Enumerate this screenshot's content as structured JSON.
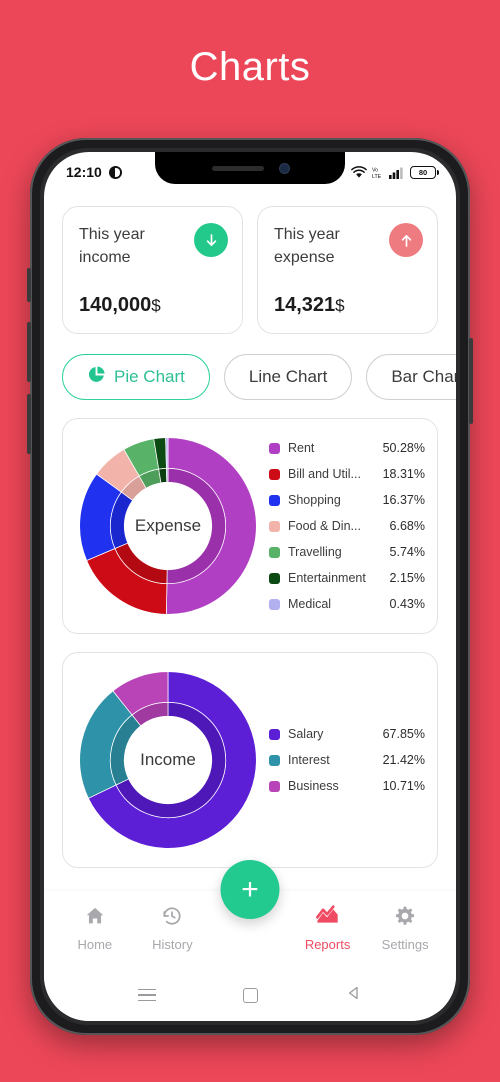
{
  "page": {
    "title": "Charts",
    "background_color": "#ec4758"
  },
  "status_bar": {
    "time": "12:10",
    "dnd_icon": "do-not-disturb-icon",
    "wifi_icon": "wifi-icon",
    "volte_icon": "volte-icon",
    "signal_icon": "signal-bars-icon",
    "battery_level": "80"
  },
  "summary": {
    "income": {
      "label": "This year income",
      "value": "140,000",
      "currency": "$",
      "badge_icon": "arrow-down-icon",
      "badge_color": "#23c98b"
    },
    "expense": {
      "label": "This year expense",
      "value": "14,321",
      "currency": "$",
      "badge_icon": "arrow-up-icon",
      "badge_color": "#ee7b7f"
    }
  },
  "chart_tabs": [
    {
      "label": "Pie Chart",
      "icon": "pie-chart-icon",
      "active": true
    },
    {
      "label": "Line Chart",
      "icon": null,
      "active": false
    },
    {
      "label": "Bar Chart",
      "icon": null,
      "active": false
    }
  ],
  "chart_data": [
    {
      "type": "pie",
      "title": "Expense",
      "center_label": "Expense",
      "legend_position": "right",
      "categories": [
        "Rent",
        "Bill and Util...",
        "Shopping",
        "Food & Din...",
        "Travelling",
        "Entertainment",
        "Medical"
      ],
      "values": [
        50.28,
        18.31,
        16.37,
        6.68,
        5.74,
        2.15,
        0.43
      ],
      "value_labels": [
        "50.28%",
        "18.31%",
        "16.37%",
        "6.68%",
        "5.74%",
        "2.15%",
        "0.43%"
      ],
      "colors": [
        "#b13fc4",
        "#cc0b17",
        "#2031f0",
        "#f2b4aa",
        "#58b368",
        "#0b4a13",
        "#b3b0ef"
      ],
      "inner_colors": [
        "#9a31ab",
        "#b30913",
        "#1a27cf",
        "#d9a099",
        "#4e9e5b",
        "#093f10",
        "#9f9cd2"
      ]
    },
    {
      "type": "pie",
      "title": "Income",
      "center_label": "Income",
      "legend_position": "right",
      "categories": [
        "Salary",
        "Interest",
        "Business"
      ],
      "values": [
        67.85,
        21.42,
        10.71
      ],
      "value_labels": [
        "67.85%",
        "21.42%",
        "10.71%"
      ],
      "colors": [
        "#5c1fd6",
        "#2e93a8",
        "#b944b8"
      ],
      "inner_colors": [
        "#4e18b8",
        "#287f92",
        "#a03aa0"
      ]
    }
  ],
  "fab": {
    "label": "+",
    "icon": "plus-icon",
    "color": "#22ca90"
  },
  "bottom_nav": [
    {
      "label": "Home",
      "icon": "home-icon",
      "active": false
    },
    {
      "label": "History",
      "icon": "history-clock-icon",
      "active": false
    },
    {
      "label": "Reports",
      "icon": "reports-chart-icon",
      "active": true
    },
    {
      "label": "Settings",
      "icon": "gear-icon",
      "active": false
    }
  ],
  "system_nav": [
    {
      "icon": "menu-icon"
    },
    {
      "icon": "home-square-icon"
    },
    {
      "icon": "back-triangle-icon"
    }
  ],
  "colors": {
    "accent_green": "#22ca90",
    "accent_pink": "#ef4b63",
    "background": "#ec4758"
  }
}
